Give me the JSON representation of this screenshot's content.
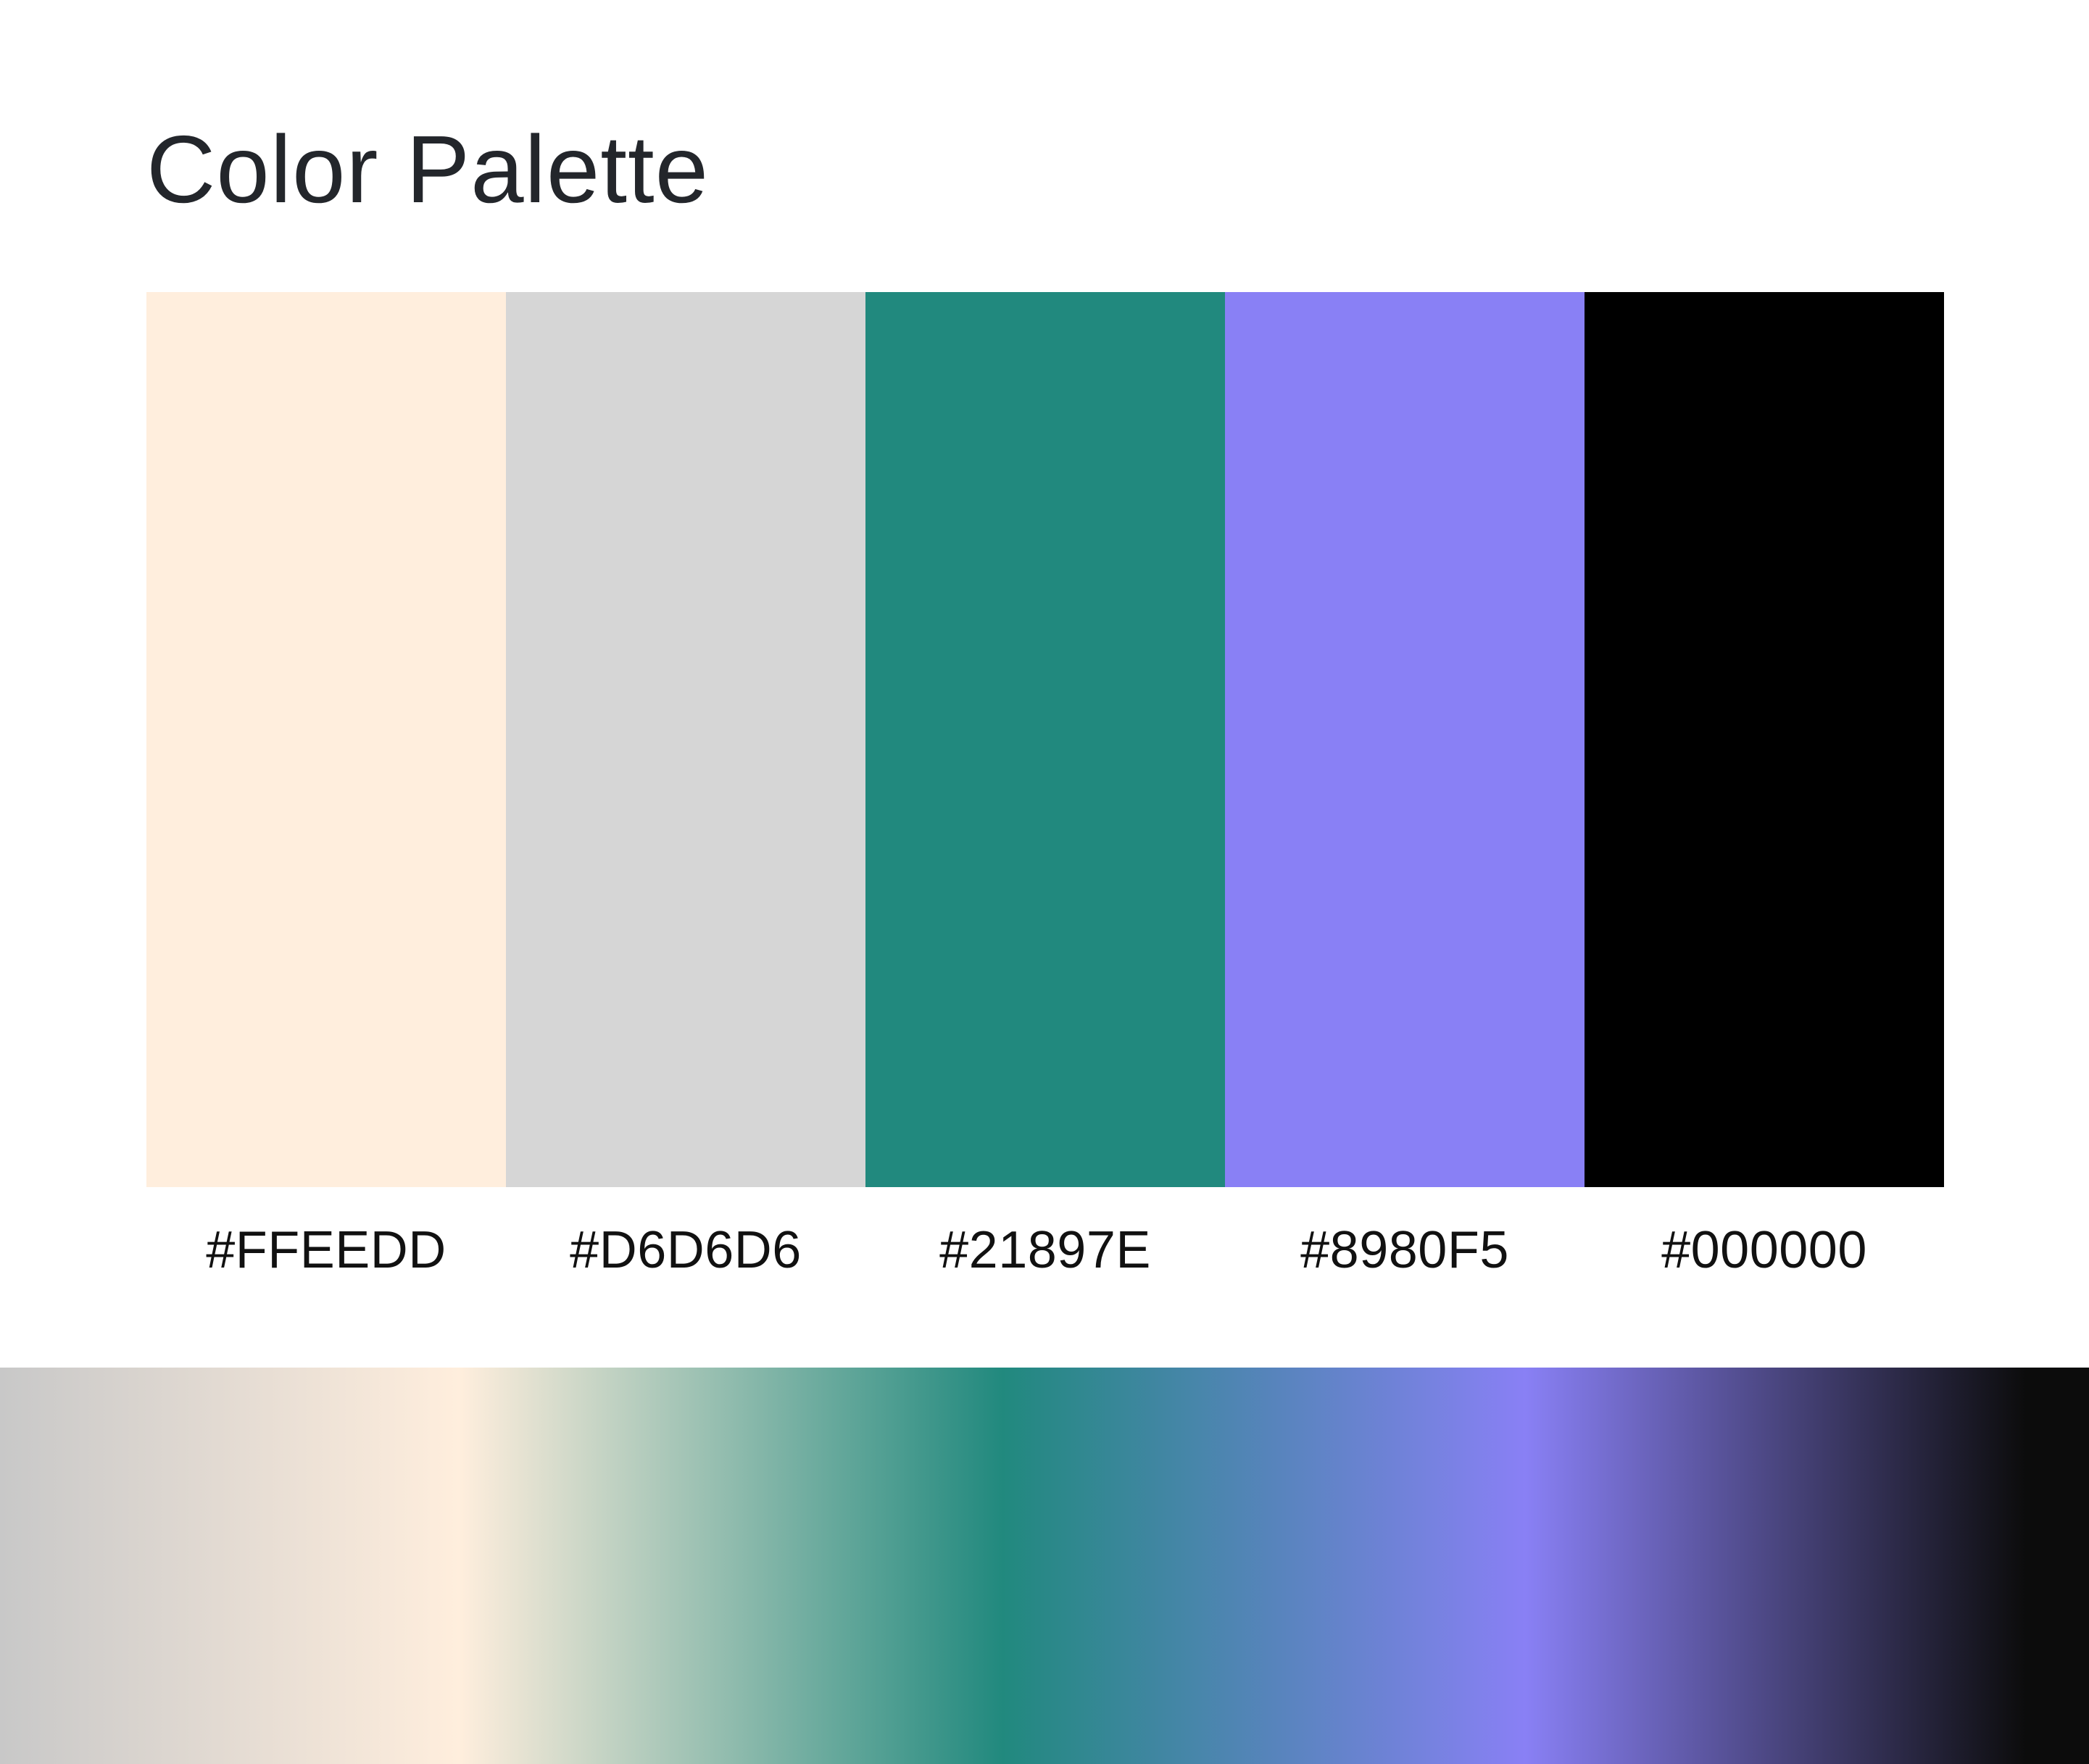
{
  "title": "Color Palette",
  "swatches": [
    {
      "label": "#FFEEDD",
      "color": "#FFEEDD"
    },
    {
      "label": "#D6D6D6",
      "color": "#D6D6D6"
    },
    {
      "label": "#21897E",
      "color": "#21897E"
    },
    {
      "label": "#8980F5",
      "color": "#8980F5"
    },
    {
      "label": "#000000",
      "color": "#000000"
    }
  ],
  "gradient": [
    "#C8C8C8",
    "#FFEEDD",
    "#21897E",
    "#8980F5",
    "#0C0C0C"
  ]
}
